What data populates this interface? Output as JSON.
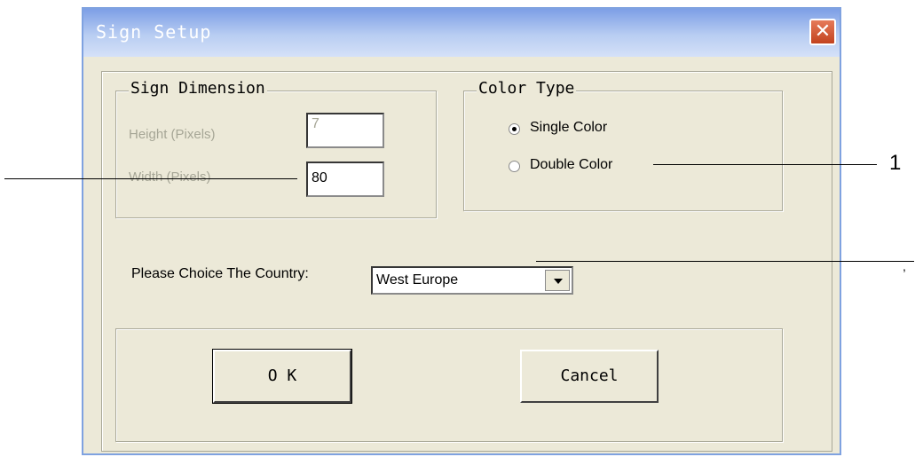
{
  "window": {
    "title": "Sign Setup",
    "close_icon": "close-icon",
    "close_glyph": "✕"
  },
  "sign_dimension": {
    "legend": "Sign Dimension",
    "height_label": "Height (Pixels)",
    "height_value": "7",
    "width_label": "Width (Pixels)",
    "width_value": "80"
  },
  "color_type": {
    "legend": "Color Type",
    "options": [
      {
        "label": "Single Color",
        "selected": true
      },
      {
        "label": "Double Color",
        "selected": false
      }
    ]
  },
  "country": {
    "label": "Please Choice The Country:",
    "selected": "West Europe"
  },
  "buttons": {
    "ok": "O K",
    "cancel": "Cancel"
  },
  "callouts": {
    "label_1": "1",
    "label_2": ","
  }
}
